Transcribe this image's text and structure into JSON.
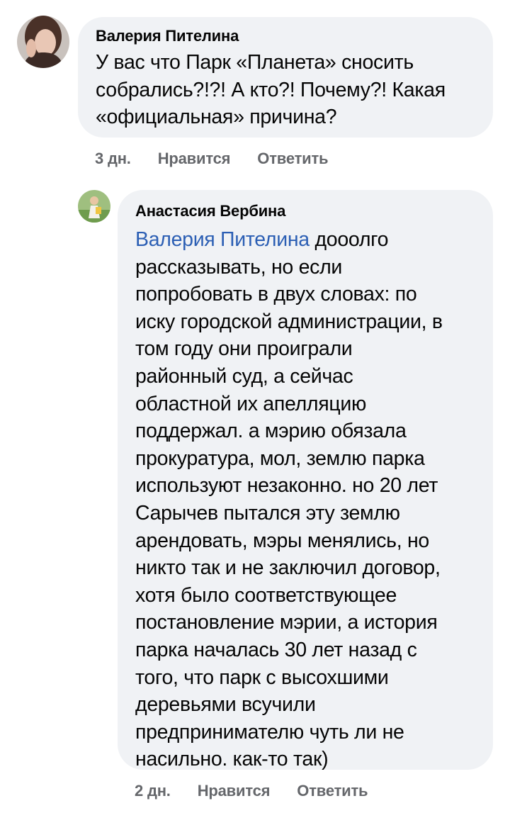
{
  "comments": [
    {
      "author": "Валерия Пителина",
      "text": "У вас что Парк «Планета» сносить\nсобрались?!?! А кто?! Почему?! Какая\n«официальная» причина?",
      "time": "3 дн.",
      "like_label": "Нравится",
      "reply_label": "Ответить"
    },
    {
      "author": "Анастасия Вербина",
      "mention": "Валерия Пителина",
      "text": " дооолго\nрассказывать, но если\nпопробовать в двух словах: по\nиску городской администрации, в\nтом году они проиграли\nрайонный суд, а сейчас\nобластной их апелляцию\nподдержал. а мэрию обязала\nпрокуратура, мол, землю парка\nиспользуют незаконно. но 20 лет\nСарычев пытался эту землю\nарендовать, мэры менялись, но\nникто так и не заключил договор,\nхотя было соответствующее\nпостановление мэрии, а история\nпарка началась 30 лет назад с\nтого, что парк с высохшими\nдеревьями всучили\nпредпринимателю чуть ли не\nнасильно. как-то так)",
      "time": "2 дн.",
      "like_label": "Нравится",
      "reply_label": "Ответить"
    }
  ]
}
